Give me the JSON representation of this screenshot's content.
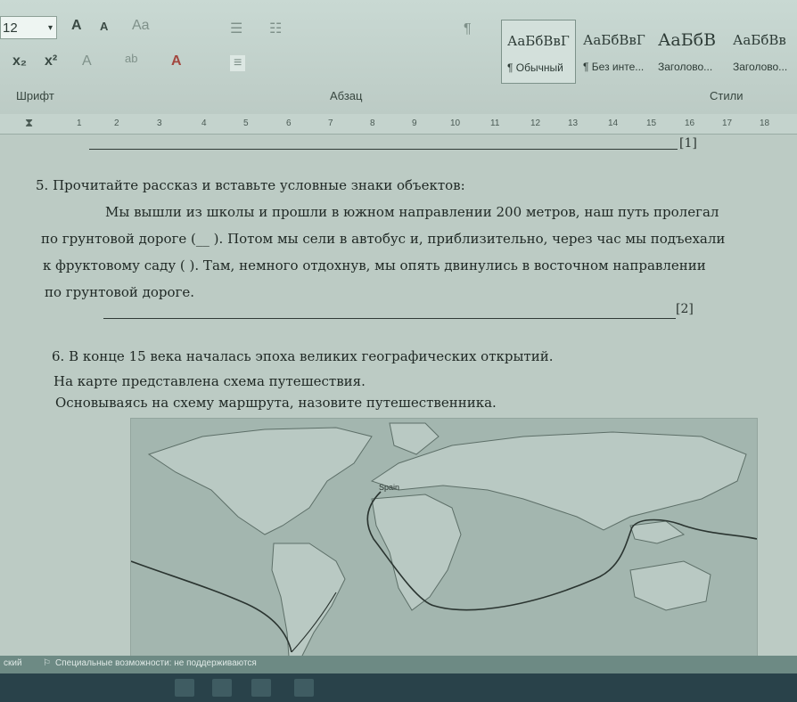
{
  "ribbon": {
    "font_size": "12",
    "font_group_label": "Шрифт",
    "paragraph_group_label": "Абзац",
    "styles_group_label": "Стили",
    "styles": [
      {
        "sample": "АаБбВвГ",
        "name": "¶ Обычный",
        "selected": true
      },
      {
        "sample": "АаБбВвГ",
        "name": "¶ Без инте...",
        "selected": false
      },
      {
        "sample": "АаБбВ",
        "name": "Заголово...",
        "selected": false
      },
      {
        "sample": "АаБбВв",
        "name": "Заголово...",
        "selected": false
      }
    ],
    "font_buttons": [
      "A",
      "A",
      "Aa",
      "x₂",
      "x²",
      "A",
      "ab",
      "A"
    ],
    "paragraph_buttons": [
      "☰",
      "☷",
      "≡",
      "¶"
    ]
  },
  "ruler": {
    "ticks": [
      "1",
      "2",
      "3",
      "4",
      "5",
      "6",
      "7",
      "8",
      "9",
      "10",
      "11",
      "12",
      "13",
      "14",
      "15",
      "16",
      "17",
      "18"
    ]
  },
  "document": {
    "mark1": "[1]",
    "q5_title": "5. Прочитайте рассказ и вставьте условные знаки объектов:",
    "q5_lines": [
      "Мы вышли из школы и прошли в южном направлении 200 метров, наш путь пролегал",
      "по грунтовой дороге (__     ). Потом мы сели в автобус и, приблизительно, через час мы подъехали",
      "к фруктовому саду (        ). Там, немного отдохнув, мы опять двинулись в восточном направлении",
      "по грунтовой дороге."
    ],
    "mark2": "[2]",
    "q6_title": "6. В конце 15 века началась эпоха великих географических открытий.",
    "q6_lines": [
      "На карте представлена схема путешествия.",
      "Основываясь на схему маршрута, назовите путешественника."
    ],
    "map_label": "Spain"
  },
  "status": {
    "language": "ский",
    "accessibility": "Специальные возможности: не поддерживаются"
  },
  "colors": {
    "route": "#2a3430",
    "land": "#b9c9c3",
    "sea": "#a3b6af"
  }
}
